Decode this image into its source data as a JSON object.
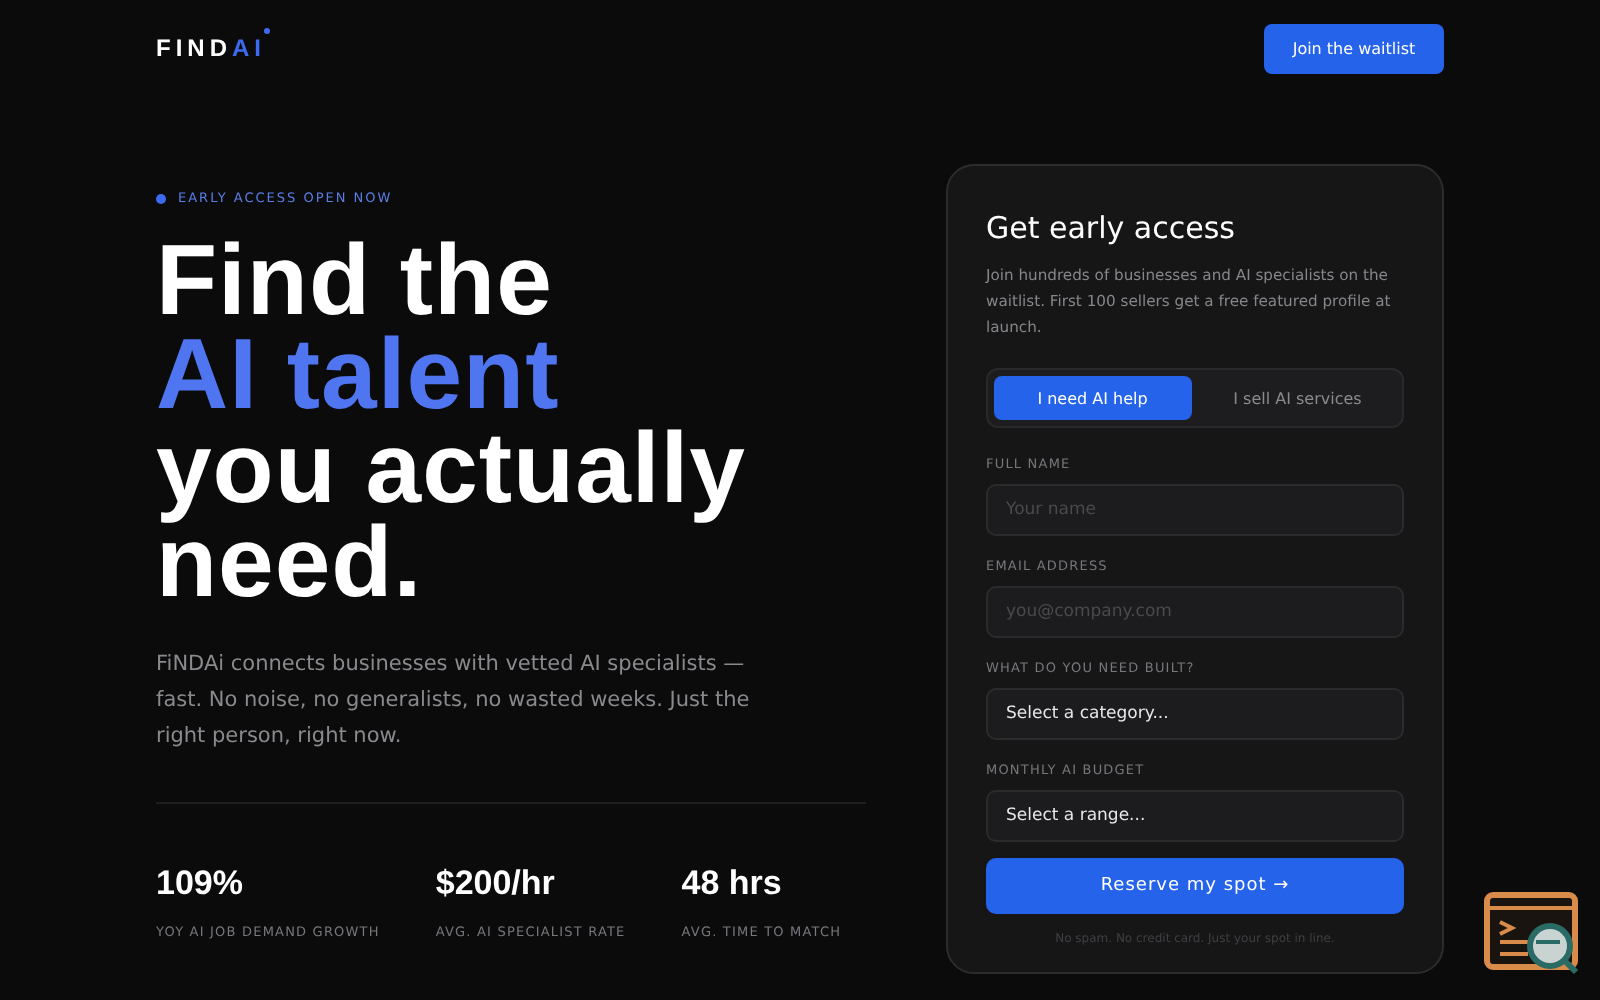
{
  "header": {
    "logo": {
      "main": "FIND",
      "accent": "AI"
    },
    "cta": "Join the waitlist"
  },
  "hero": {
    "tag": "EARLY ACCESS OPEN NOW",
    "headline": [
      {
        "text": "Find the",
        "accent": false
      },
      {
        "text": "AI talent",
        "accent": true
      },
      {
        "text": "you actually",
        "accent": false
      },
      {
        "text": "need.",
        "accent": false
      }
    ],
    "description": "FiNDAi connects businesses with vetted AI specialists — fast. No noise, no generalists, no wasted weeks. Just the right person, right now.",
    "stats": [
      {
        "value": "109%",
        "label": "YOY AI JOB DEMAND GROWTH"
      },
      {
        "value": "$200/hr",
        "label": "AVG. AI SPECIALIST RATE"
      },
      {
        "value": "48 hrs",
        "label": "AVG. TIME TO MATCH"
      }
    ]
  },
  "form": {
    "title": "Get early access",
    "description": "Join hundreds of businesses and AI specialists on the waitlist. First 100 sellers get a free featured profile at launch.",
    "tabs": [
      {
        "label": "I need AI help",
        "selected": true
      },
      {
        "label": "I sell AI services",
        "selected": false
      }
    ],
    "fields": [
      {
        "kind": "input",
        "label": "FULL NAME",
        "placeholder": "Your name"
      },
      {
        "kind": "input",
        "label": "EMAIL ADDRESS",
        "placeholder": "you@company.com"
      },
      {
        "kind": "select",
        "label": "WHAT DO YOU NEED BUILT?",
        "value": "Select a category..."
      },
      {
        "kind": "select",
        "label": "MONTHLY AI BUDGET",
        "value": "Select a range..."
      }
    ],
    "submit": "Reserve my spot →",
    "note": "No spam. No credit card. Just your spot in line."
  }
}
